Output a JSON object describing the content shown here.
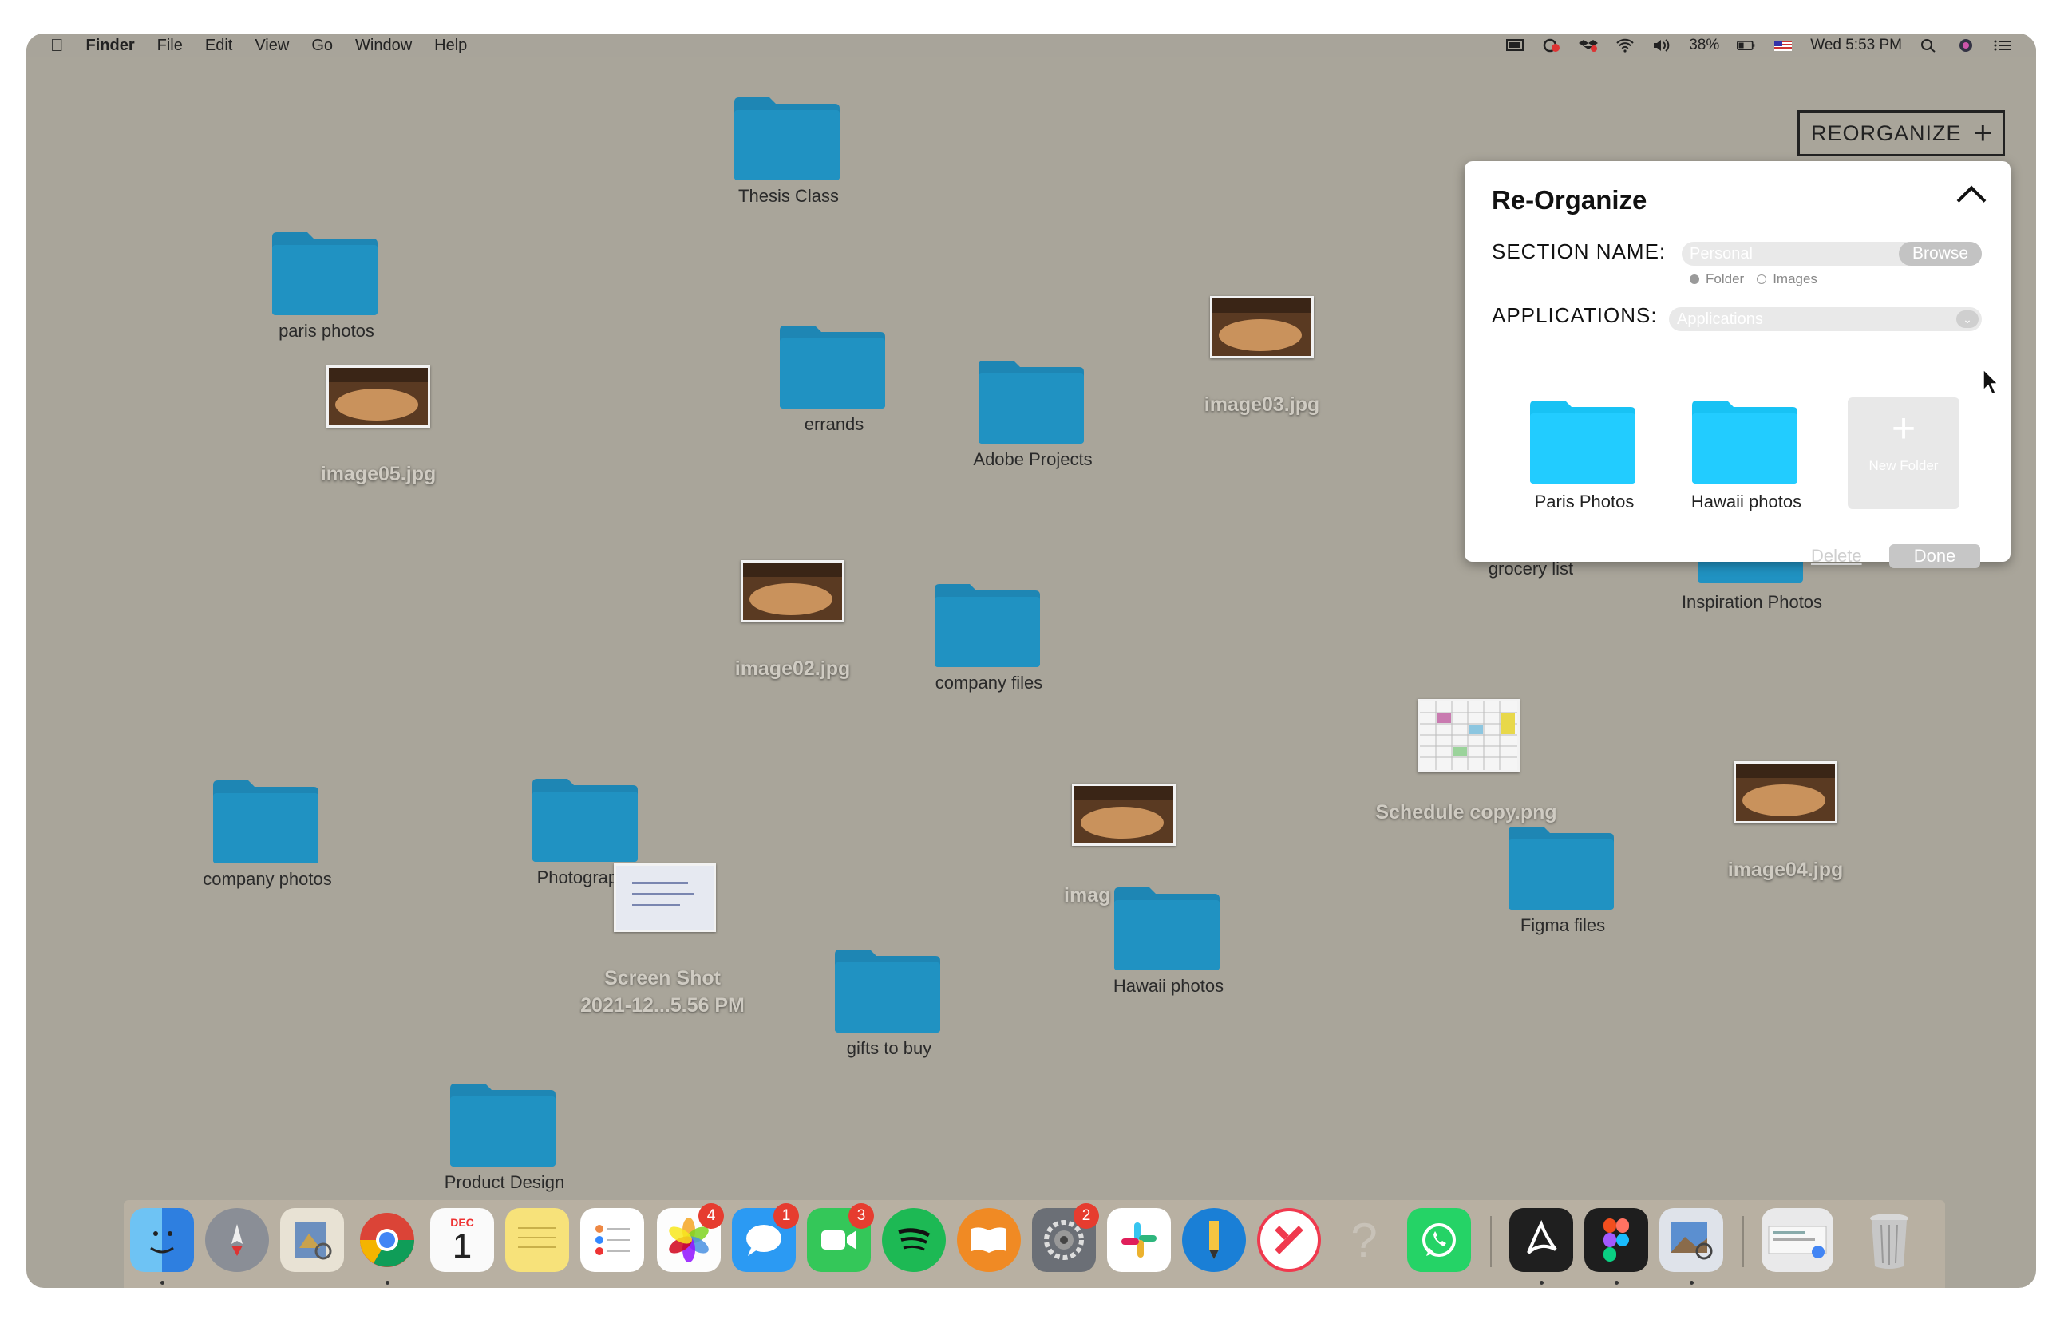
{
  "menubar": {
    "app": "Finder",
    "items": [
      "File",
      "Edit",
      "View",
      "Go",
      "Window",
      "Help"
    ],
    "battery": "38%",
    "clock": "Wed 5:53 PM"
  },
  "desktop": {
    "folders": {
      "thesis": "Thesis Class",
      "paris": "paris photos",
      "errands": "errands",
      "adobe": "Adobe Projects",
      "company_files": "company files",
      "company_photos": "company photos",
      "photography": "Photography",
      "gifts": "gifts to buy",
      "hawaii": "Hawaii photos",
      "product": "Product Design",
      "figma": "Figma files",
      "inspiration": "Inspiration Photos",
      "grocery": "grocery list"
    },
    "images": {
      "image05": "image05.jpg",
      "image03": "image03.jpg",
      "image02": "image02.jpg",
      "image_partial": "imag",
      "schedule": "Schedule copy.png",
      "image04": "image04.jpg",
      "screenshot_l1": "Screen Shot",
      "screenshot_l2": "2021-12...5.56 PM"
    }
  },
  "reorganize_button": {
    "label": "REORGANIZE"
  },
  "panel": {
    "title": "Re-Organize",
    "section_label": "SECTION NAME:",
    "section_placeholder": "Personal",
    "browse_label": "Browse",
    "radio_folder": "Folder",
    "radio_images": "Images",
    "applications_label": "APPLICATIONS:",
    "applications_placeholder": "Applications",
    "folders": [
      "Paris Photos",
      "Hawaii photos"
    ],
    "new_folder": "New Folder",
    "delete_label": "Delete",
    "done_label": "Done"
  },
  "dock": {
    "badges": {
      "photos": "4",
      "messages": "1",
      "facetime": "3",
      "sysprefs": "2"
    },
    "calendar_month": "DEC",
    "calendar_day": "1"
  }
}
